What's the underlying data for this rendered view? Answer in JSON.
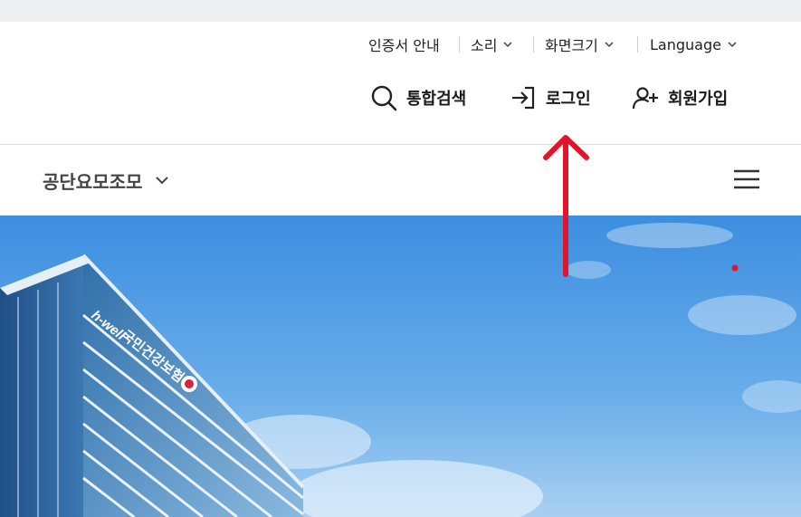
{
  "utility": {
    "cert_guide": "인증서 안내",
    "sound": "소리",
    "screen_size": "화면크기",
    "language": "Language"
  },
  "nav": {
    "search": "통합검색",
    "login": "로그인",
    "signup": "회원가입"
  },
  "site_selector": {
    "label": "공단요모조모"
  },
  "hero": {
    "sign_brand": "h-well",
    "sign_text": "국민건강보험"
  },
  "colors": {
    "text_dark": "#1a1a1a",
    "annotation_red": "#e0152b",
    "sky_top": "#3c8ee0",
    "strip": "#eceef2"
  }
}
